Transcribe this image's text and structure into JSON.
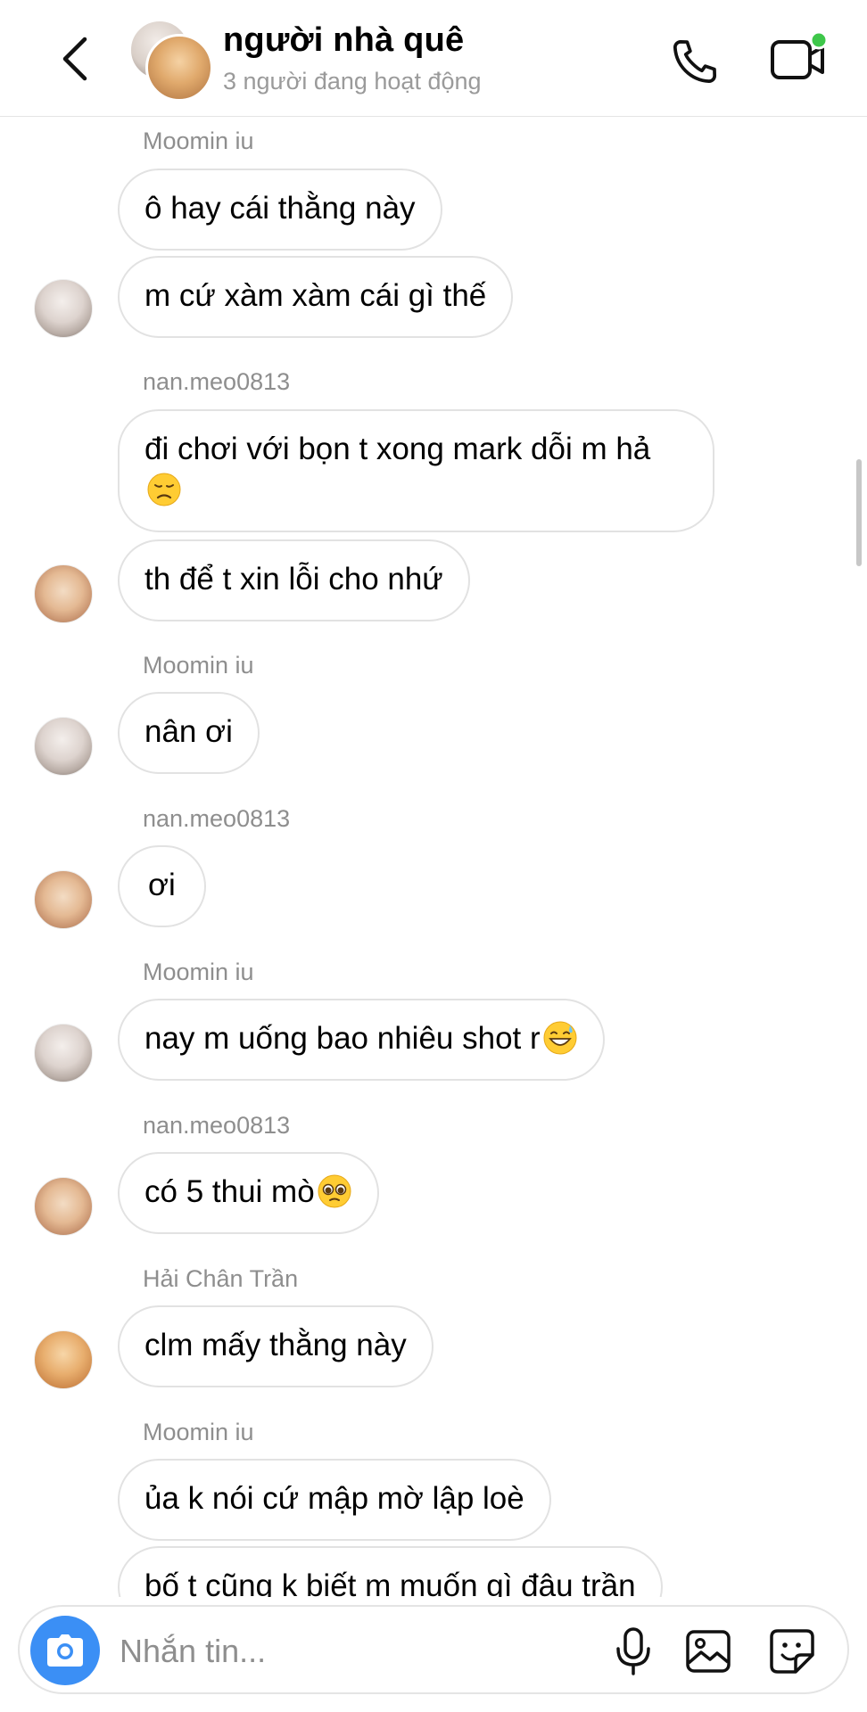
{
  "header": {
    "title": "người nhà quê",
    "status": "3 người đang hoạt động",
    "icons": {
      "back": "chevron-left-icon",
      "call": "phone-icon",
      "video": "video-camera-icon"
    },
    "active_dot_color": "#3ec74a"
  },
  "messages": [
    {
      "sender": "Moomin iu",
      "texts": [
        "ô hay cái thằng này",
        "m cứ xàm xàm cái gì thế"
      ],
      "avatar": "moomin"
    },
    {
      "sender": "nan.meo0813",
      "texts": [
        "đi chơi với bọn t xong mark dỗi m hả",
        "th để t xin lỗi cho nhứ"
      ],
      "emoji": "disappointed-face-emoji",
      "avatar": "nan"
    },
    {
      "sender": "Moomin iu",
      "texts": [
        "nân ơi"
      ],
      "avatar": "moomin"
    },
    {
      "sender": "nan.meo0813",
      "texts": [
        "ơi"
      ],
      "avatar": "nan"
    },
    {
      "sender": "Moomin iu",
      "texts": [
        "nay m uống bao nhiêu shot r"
      ],
      "emoji": "grinning-sweat-emoji",
      "avatar": "moomin"
    },
    {
      "sender": "nan.meo0813",
      "texts": [
        "có 5 thui mò"
      ],
      "emoji": "pleading-face-emoji",
      "avatar": "nan"
    },
    {
      "sender": "Hải Chân Trần",
      "texts": [
        "clm mấy thằng này"
      ],
      "avatar": "hai"
    },
    {
      "sender": "Moomin iu",
      "texts": [
        "ủa k nói cứ mập mờ lập loè",
        "bố t cũng k biết m muốn gì đâu trần"
      ],
      "avatar": "moomin"
    }
  ],
  "composer": {
    "placeholder": "Nhắn tin...",
    "icons": [
      "camera-icon",
      "microphone-icon",
      "gallery-icon",
      "sticker-icon"
    ],
    "camera_color": "#3b8ff5"
  }
}
